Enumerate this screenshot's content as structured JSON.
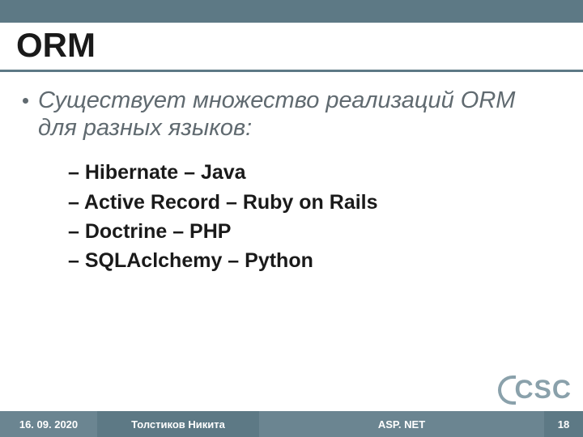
{
  "title": "ORM",
  "lead": "Существует множество реализаций ORM для разных языков:",
  "items": [
    "– Hibernate – Java",
    "– Active Record – Ruby on Rails",
    "– Doctrine – PHP",
    "– SQLAclchemy – Python"
  ],
  "footer": {
    "date": "16. 09. 2020",
    "author": "Толстиков Никита",
    "topic": "ASP. NET",
    "page": "18"
  },
  "logo_text": "CSC"
}
